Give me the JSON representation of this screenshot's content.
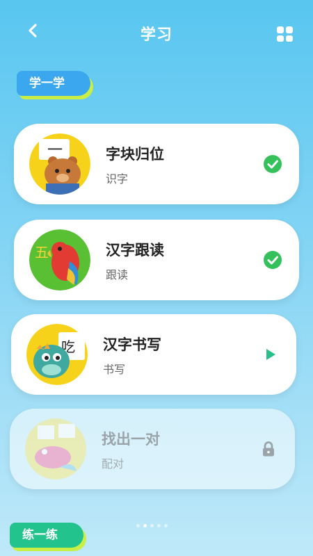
{
  "header": {
    "title": "学习",
    "back_icon": "chevron-left-icon",
    "menu_icon": "grid-icon"
  },
  "sections": {
    "learn_label": "学一学",
    "practice_label": "练一练"
  },
  "lessons": [
    {
      "title": "字块归位",
      "subtitle": "识字",
      "status": "completed",
      "thumb_text": "一"
    },
    {
      "title": "汉字跟读",
      "subtitle": "跟读",
      "status": "completed",
      "thumb_text": "五"
    },
    {
      "title": "汉字书写",
      "subtitle": "书写",
      "status": "play",
      "thumb_text": "吃"
    },
    {
      "title": "找出一对",
      "subtitle": "配对",
      "status": "locked",
      "thumb_text": ""
    }
  ],
  "pager": {
    "count": 5,
    "active": 1
  },
  "colors": {
    "check": "#34c15b",
    "play": "#28c08a",
    "lock": "#9aa3a8",
    "tag_learn": "#3aa7ee",
    "tag_practice": "#23c38d"
  }
}
